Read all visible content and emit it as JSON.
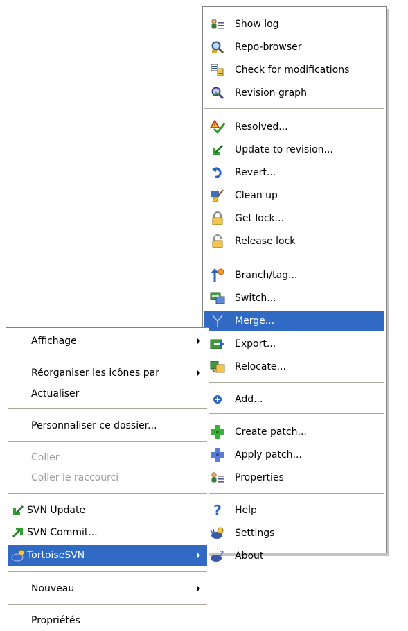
{
  "tortoise_submenu": {
    "items": [
      {
        "label": "Show log",
        "icon": "show-log-icon"
      },
      {
        "label": "Repo-browser",
        "icon": "repo-browser-icon"
      },
      {
        "label": "Check for modifications",
        "icon": "check-modifications-icon"
      },
      {
        "label": "Revision graph",
        "icon": "revision-graph-icon"
      },
      {
        "label": "Resolved...",
        "icon": "resolved-icon"
      },
      {
        "label": "Update to revision...",
        "icon": "update-revision-icon"
      },
      {
        "label": "Revert...",
        "icon": "revert-icon"
      },
      {
        "label": "Clean up",
        "icon": "cleanup-icon"
      },
      {
        "label": "Get lock...",
        "icon": "lock-icon"
      },
      {
        "label": "Release lock",
        "icon": "unlock-icon"
      },
      {
        "label": "Branch/tag...",
        "icon": "branch-tag-icon"
      },
      {
        "label": "Switch...",
        "icon": "switch-icon"
      },
      {
        "label": "Merge...",
        "icon": "merge-icon",
        "selected": true
      },
      {
        "label": "Export...",
        "icon": "export-icon"
      },
      {
        "label": "Relocate...",
        "icon": "relocate-icon"
      },
      {
        "label": "Add...",
        "icon": "add-icon"
      },
      {
        "label": "Create patch...",
        "icon": "create-patch-icon"
      },
      {
        "label": "Apply patch...",
        "icon": "apply-patch-icon"
      },
      {
        "label": "Properties",
        "icon": "properties-icon"
      },
      {
        "label": "Help",
        "icon": "help-icon"
      },
      {
        "label": "Settings",
        "icon": "settings-icon"
      },
      {
        "label": "About",
        "icon": "about-icon"
      }
    ]
  },
  "context_menu": {
    "items": [
      {
        "label": "Affichage",
        "submenu": true
      },
      {
        "label": "Réorganiser les icônes par",
        "submenu": true
      },
      {
        "label": "Actualiser"
      },
      {
        "label": "Personnaliser ce dossier..."
      },
      {
        "label": "Coller",
        "disabled": true
      },
      {
        "label": "Coller le raccourci",
        "disabled": true
      },
      {
        "label": "SVN Update",
        "icon": "svn-update-icon"
      },
      {
        "label": "SVN Commit...",
        "icon": "svn-commit-icon"
      },
      {
        "label": "TortoiseSVN",
        "icon": "tortoisesvn-icon",
        "submenu": true,
        "selected": true
      },
      {
        "label": "Nouveau",
        "submenu": true
      },
      {
        "label": "Propriétés"
      }
    ]
  },
  "colors": {
    "highlight": "#316ac5",
    "disabled_text": "#9b9b9b",
    "separator": "#aca899"
  }
}
